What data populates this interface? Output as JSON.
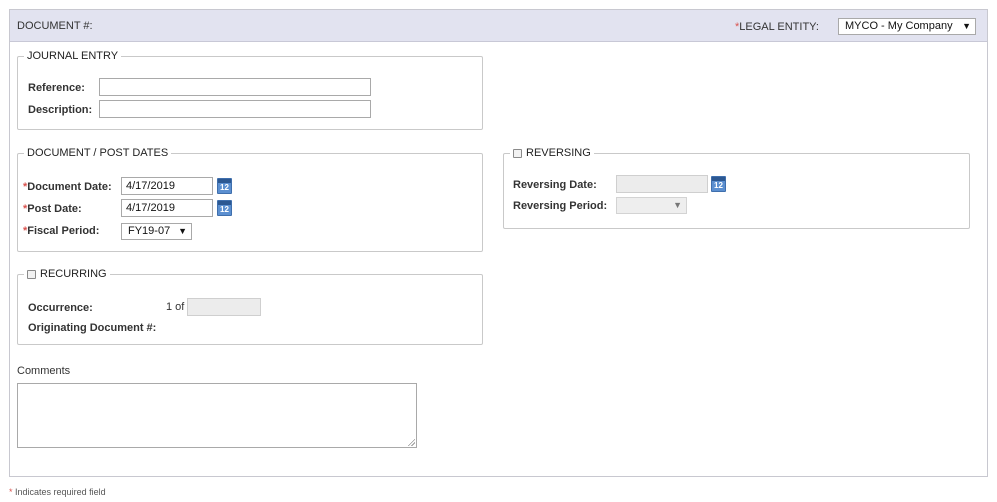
{
  "header": {
    "document_label": "DOCUMENT #:",
    "legal_entity_label": "LEGAL ENTITY:",
    "legal_entity_value": "MYCO - My Company",
    "required_mark": "*"
  },
  "journal_entry": {
    "legend": "JOURNAL ENTRY",
    "reference_label": "Reference:",
    "reference_value": "",
    "description_label": "Description:",
    "description_value": ""
  },
  "dates": {
    "legend": "DOCUMENT / POST DATES",
    "document_date_label": "Document Date:",
    "document_date_value": "4/17/2019",
    "post_date_label": "Post Date:",
    "post_date_value": "4/17/2019",
    "fiscal_period_label": "Fiscal Period:",
    "fiscal_period_value": "FY19-07"
  },
  "reversing": {
    "legend": "REVERSING",
    "checked": false,
    "date_label": "Reversing Date:",
    "date_value": "",
    "period_label": "Reversing Period:",
    "period_value": ""
  },
  "recurring": {
    "legend": "RECURRING",
    "checked": false,
    "occurrence_label": "Occurrence:",
    "occurrence_prefix": "1 of",
    "occurrence_value": "",
    "originating_label": "Originating Document #:"
  },
  "comments": {
    "label": "Comments",
    "value": ""
  },
  "footer": {
    "required_note": "Indicates required field"
  },
  "calendar_icon_text": "12",
  "colors": {
    "header_bg": "#e2e3f0",
    "required": "#d9534f",
    "calendar_icon": "#5b8fd0"
  }
}
